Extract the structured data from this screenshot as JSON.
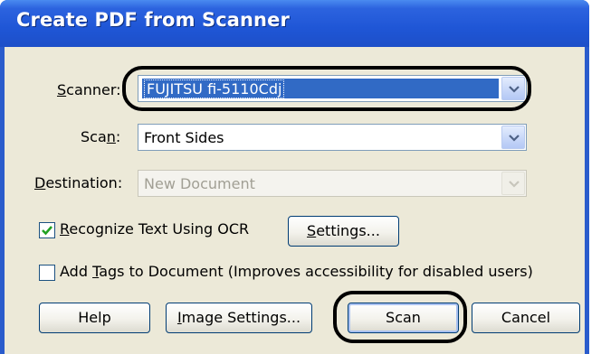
{
  "window": {
    "title": "Create PDF from Scanner"
  },
  "form": {
    "scanner": {
      "label": "Scanner:",
      "label_ul": "S",
      "label_rest": "canner:",
      "value": "FUJITSU fi-5110Cdj"
    },
    "scan": {
      "label_pre": "Sca",
      "label_ul": "n",
      "label_post": ":",
      "value": "Front Sides"
    },
    "destination": {
      "label_ul": "D",
      "label_rest": "estination:",
      "value": "New Document"
    },
    "ocr": {
      "checked": true,
      "label_ul": "R",
      "label_rest": "ecognize Text Using OCR",
      "settings_ul": "S",
      "settings_rest": "ettings..."
    },
    "tags": {
      "checked": false,
      "label_pre": "Add ",
      "label_ul": "T",
      "label_rest": "ags to Document (Improves accessibility for disabled users)"
    }
  },
  "buttons": {
    "help": "Help",
    "image_settings_ul": "I",
    "image_settings_rest": "mage Settings...",
    "scan": "Scan",
    "cancel": "Cancel"
  },
  "icons": [
    "chevron-down-icon",
    "checkmark-icon"
  ],
  "colors": {
    "title_bar": "#2c63df",
    "selection": "#316ac5",
    "dialog_bg": "#ece9d8",
    "annotation_ring": "#000000"
  }
}
